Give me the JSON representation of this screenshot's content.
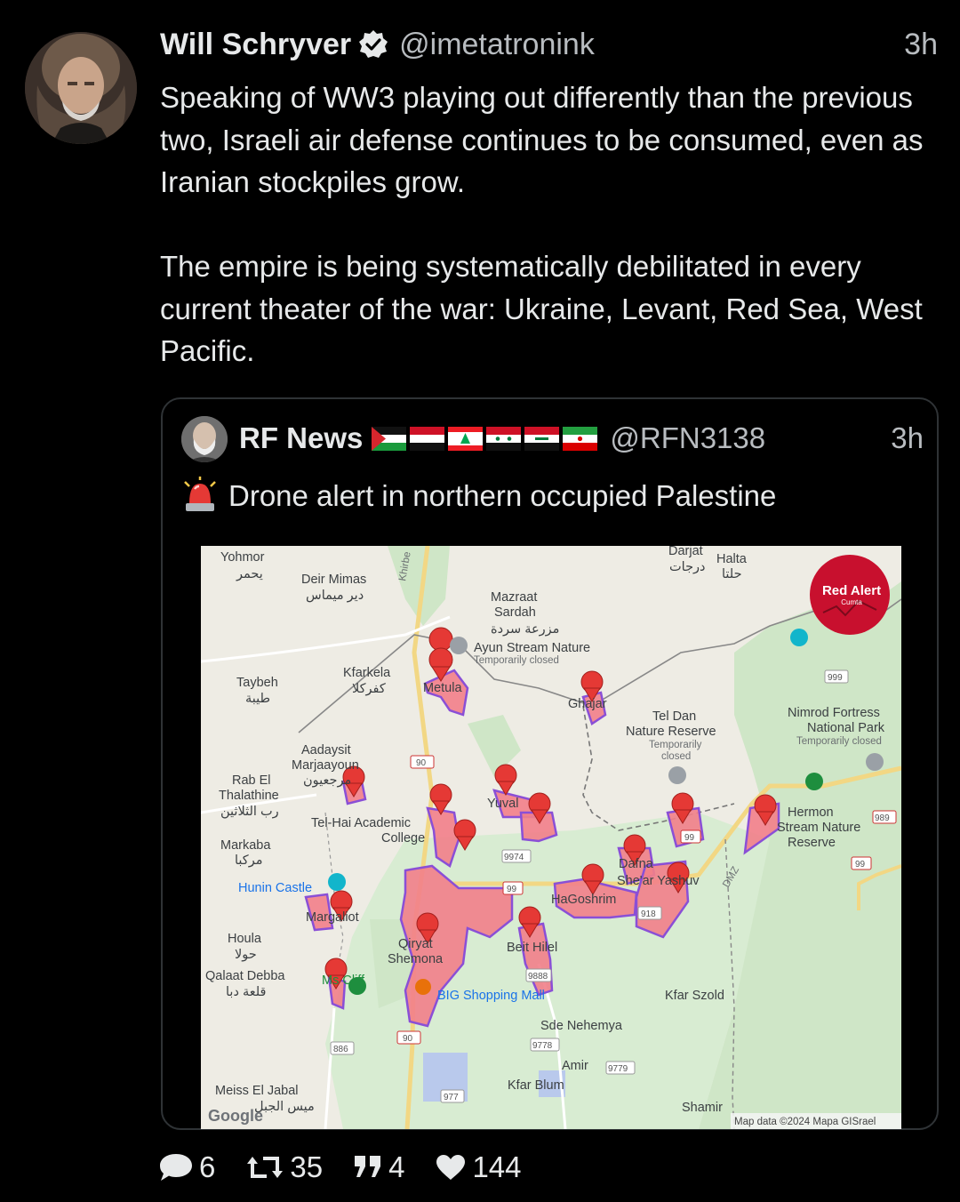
{
  "tweet": {
    "author_name": "Will Schryver",
    "handle": "@imetatronink",
    "time": "3h",
    "verified": true,
    "paragraph1": "Speaking of WW3 playing out differently than the previous two, Israeli air defense continues to be consumed, even as Iranian stockpiles grow.",
    "paragraph2": "The empire is being systematically debilitated in every current theater of the war: Ukraine, Levant, Red Sea, West Pacific."
  },
  "quote": {
    "author_name": "RF News",
    "flags": [
      "palestine-flag",
      "yemen-flag",
      "lebanon-flag",
      "syria-flag",
      "iraq-flag",
      "iran-flag"
    ],
    "handle": "@RFN3138",
    "time": "3h",
    "emoji": "siren-icon",
    "text": "Drone alert in northern occupied Palestine"
  },
  "map": {
    "badge_title": "Red Alert",
    "badge_subtitle": "Cumta",
    "attribution": "Map data ©2024 Mapa GISrael",
    "google": "Google",
    "labels": {
      "yohmor": "Yohmor",
      "yohmor_ar": "يحمر",
      "deir_mimas": "Deir Mimas",
      "deir_mimas_ar": "دير ميماس",
      "khirbe": "Khirbe",
      "darjat": "Darjat",
      "darjat_ar": "درجات",
      "halta": "Halta",
      "halta_ar": "حلتا",
      "mazraat": "Mazraat",
      "sardah": "Sardah",
      "mazraat_ar": "مزرعة سردة",
      "ayun": "Ayun Stream Nature",
      "ayun_closed": "Temporarily closed",
      "kfarkela": "Kfarkela",
      "kfarkela_ar": "كفركلا",
      "metula": "Metula",
      "taybeh": "Taybeh",
      "taybeh_ar": "طيبة",
      "ghajar": "Ghajar",
      "tel_dan1": "Tel Dan",
      "tel_dan2": "Nature Reserve",
      "tel_dan_closed1": "Temporarily",
      "tel_dan_closed2": "closed",
      "nimrod1": "Nimrod Fortress",
      "nimrod2": "National Park",
      "nimrod_closed": "Temporarily closed",
      "aadaysit": "Aadaysit",
      "marjaayoun": "Marjaayoun",
      "marjaayoun_ar": "مرجعيون",
      "rab_el": "Rab El",
      "thalathine": "Thalathine",
      "rab_ar": "رب الثلاثين",
      "tel_hai": "Tel-Hai Academic",
      "college": "College",
      "yuval": "Yuval",
      "hermon1": "Hermon",
      "hermon2": "Stream Nature",
      "hermon3": "Reserve",
      "markaba": "Markaba",
      "markaba_ar": "مركبا",
      "hunin": "Hunin Castle",
      "dafna": "Dafna",
      "shear": "She'ar Yashuv",
      "hagoshrim": "HaGoshrim",
      "dmz": "DMZ",
      "margaliot": "Margaliot",
      "houla": "Houla",
      "houla_ar": "حولا",
      "qiryat": "Qiryat",
      "shemona": "Shemona",
      "beit_hilel": "Beit Hilel",
      "qalaat": "Qalaat Debba",
      "qalaat_ar": "قلعة دبا",
      "cliff": "Ms Cliff",
      "big_mall": "BIG Shopping Mall",
      "kfar_szold": "Kfar Szold",
      "sde_nehemya": "Sde Nehemya",
      "amir": "Amir",
      "kfar_blum": "Kfar Blum",
      "meiss": "Meiss El Jabal",
      "meiss_ar": "ميس الجبل",
      "shamir": "Shamir"
    },
    "route_shields": [
      "999",
      "90",
      "9974",
      "99",
      "99",
      "989",
      "99",
      "918",
      "9888",
      "90",
      "886",
      "9778",
      "9779",
      "977"
    ]
  },
  "actions": {
    "replies": "6",
    "retweets": "35",
    "quotes": "4",
    "likes": "144"
  },
  "colors": {
    "background": "#000000",
    "text": "#e7e9ea",
    "muted": "#b8bcc0",
    "verified": "#e7e9ea",
    "alert_fill": "#f2808a",
    "alert_stroke": "#8a4fd6",
    "pin": "#e53935",
    "badge": "#c8102e"
  }
}
